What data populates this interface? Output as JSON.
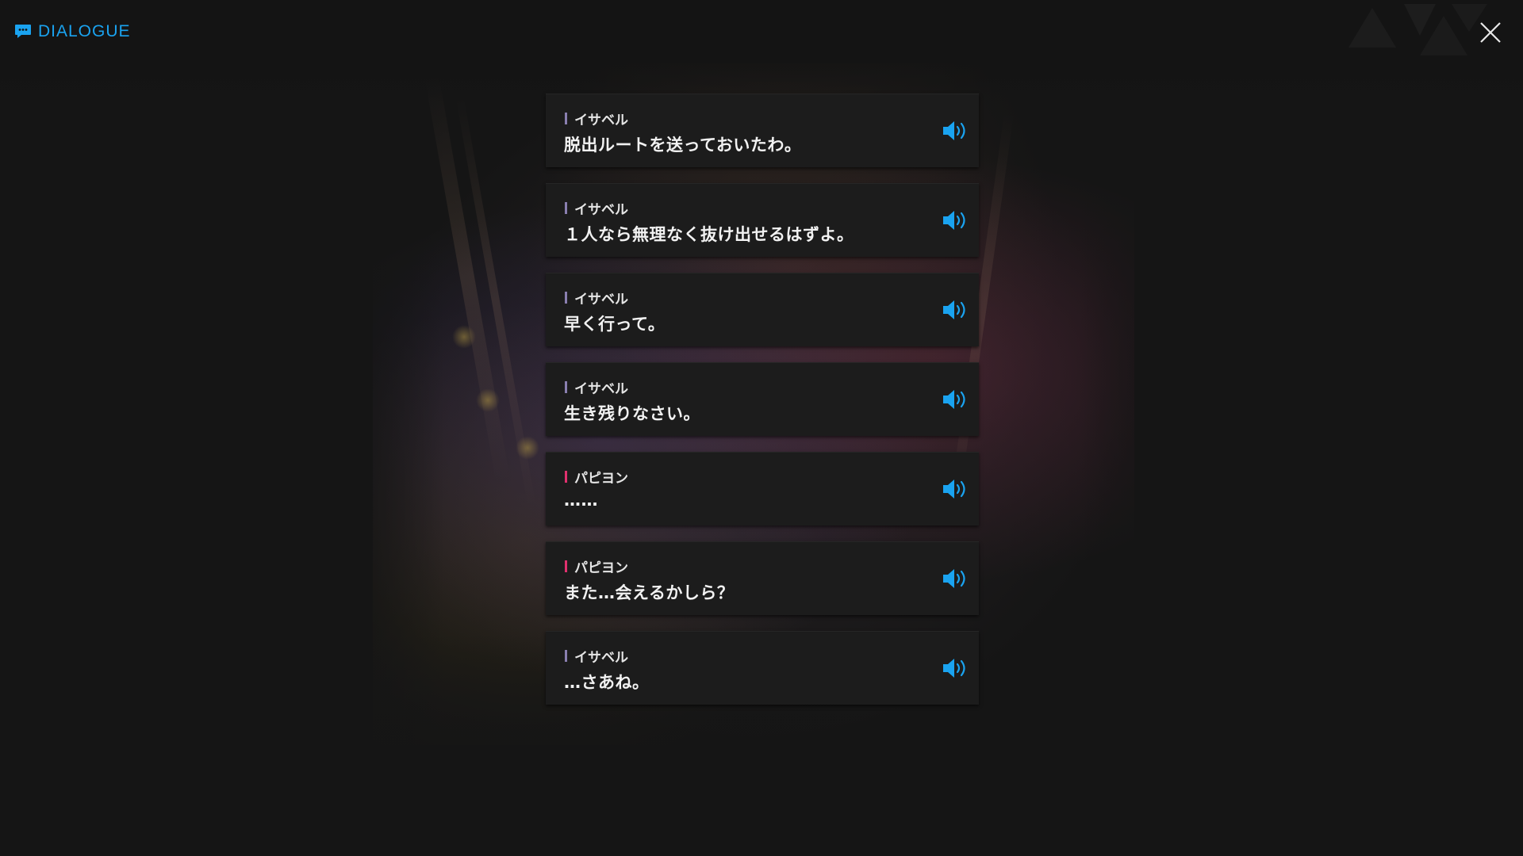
{
  "header": {
    "title": "DIALOGUE",
    "icon": "chat-bubble-icon",
    "accent_color": "#1aa3f0"
  },
  "close_icon": "close-icon",
  "voice_icon": "speaker-icon",
  "speaker_colors": {
    "イサベル": "#8a7fb0",
    "パピヨン": "#e0306e"
  },
  "dialogue": [
    {
      "speaker": "イサベル",
      "text": "脱出ルートを送っておいたわ。"
    },
    {
      "speaker": "イサベル",
      "text": "１人なら無理なく抜け出せるはずよ。"
    },
    {
      "speaker": "イサベル",
      "text": "早く行って。"
    },
    {
      "speaker": "イサベル",
      "text": "生き残りなさい。"
    },
    {
      "speaker": "パピヨン",
      "text": "……"
    },
    {
      "speaker": "パピヨン",
      "text": "また…会えるかしら？"
    },
    {
      "speaker": "イサベル",
      "text": "…さあね。"
    }
  ]
}
